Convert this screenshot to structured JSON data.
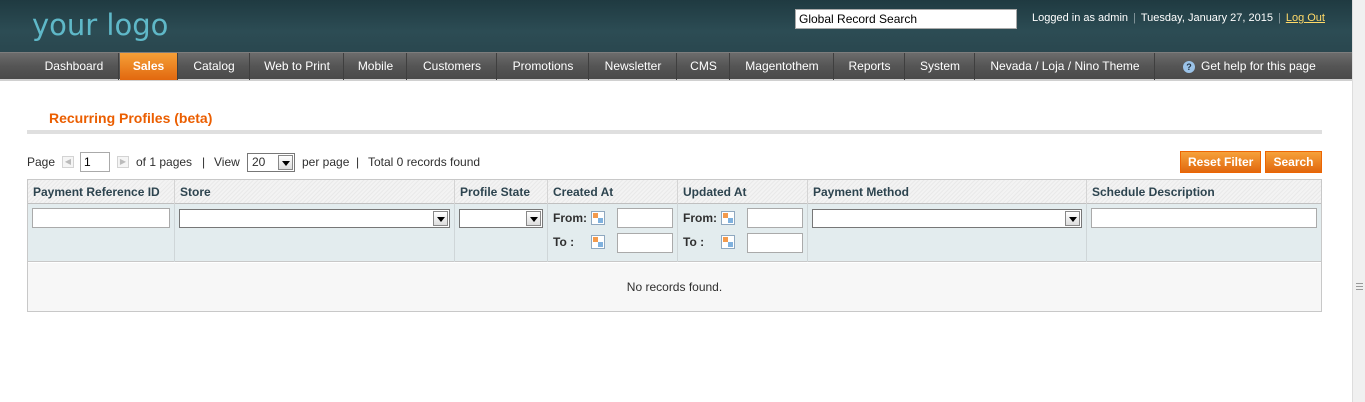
{
  "header": {
    "logo_text": "your logo",
    "search_value": "Global Record Search",
    "logged_in_text": "Logged in as admin",
    "date_text": "Tuesday, January 27, 2015",
    "logout_label": "Log Out"
  },
  "nav": {
    "items": [
      {
        "label": "Dashboard"
      },
      {
        "label": "Sales",
        "active": true
      },
      {
        "label": "Catalog"
      },
      {
        "label": "Web to Print"
      },
      {
        "label": "Mobile"
      },
      {
        "label": "Customers"
      },
      {
        "label": "Promotions"
      },
      {
        "label": "Newsletter"
      },
      {
        "label": "CMS"
      },
      {
        "label": "Magentothem"
      },
      {
        "label": "Reports"
      },
      {
        "label": "System"
      },
      {
        "label": "Nevada / Loja / Nino Theme"
      }
    ],
    "help_label": "Get help for this page"
  },
  "page": {
    "title": "Recurring Profiles (beta)"
  },
  "pager": {
    "page_label": "Page",
    "page_value": "1",
    "of_pages": "of 1 pages",
    "sep1": "|",
    "view_label": "View",
    "view_value": "20",
    "per_page": "per page",
    "sep2": "|",
    "total": "Total 0 records found"
  },
  "buttons": {
    "reset_filter": "Reset Filter",
    "search": "Search"
  },
  "grid": {
    "columns": [
      "Payment Reference ID",
      "Store",
      "Profile State",
      "Created At",
      "Updated At",
      "Payment Method",
      "Schedule Description"
    ],
    "from_label": "From:",
    "to_label": "To :",
    "empty_text": "No records found."
  },
  "colors": {
    "accent": "#eb5e00",
    "header_bg": "#2c4c54",
    "nav_bg": "#555555",
    "logo": "#5fb8c8"
  }
}
